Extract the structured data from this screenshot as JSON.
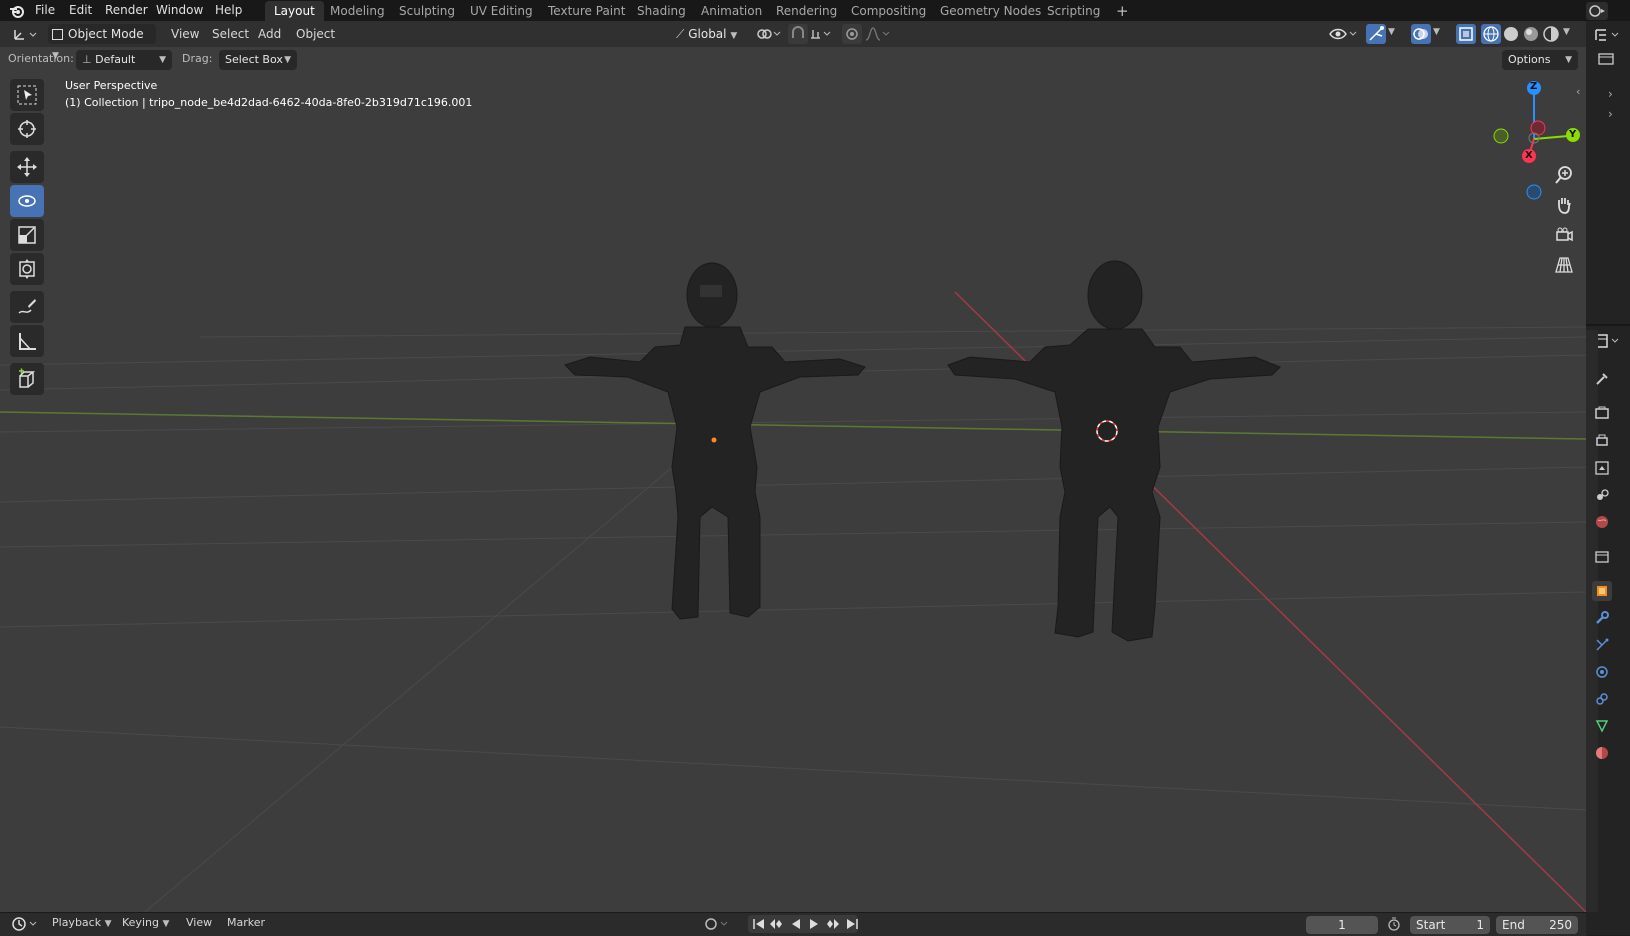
{
  "menubar": {
    "items": [
      "File",
      "Edit",
      "Render",
      "Window",
      "Help"
    ],
    "workspaces": [
      "Layout",
      "Modeling",
      "Sculpting",
      "UV Editing",
      "Texture Paint",
      "Shading",
      "Animation",
      "Rendering",
      "Compositing",
      "Geometry Nodes",
      "Scripting"
    ],
    "active_workspace": "Layout",
    "add_tab": "+"
  },
  "header": {
    "mode": "Object Mode",
    "menus": [
      "View",
      "Select",
      "Add",
      "Object"
    ],
    "transform_orientation": "Global"
  },
  "tool_settings": {
    "orientation_label": "Orientation:",
    "orientation_value": "Default",
    "drag_label": "Drag:",
    "drag_value": "Select Box",
    "options": "Options"
  },
  "viewport": {
    "perspective": "User Perspective",
    "collection_info": "(1) Collection | tripo_node_be4d2dad-6462-40da-8fe0-2b319d71c196.001",
    "gizmo_axes": {
      "z": "Z",
      "y": "Y",
      "x": "X"
    },
    "axis_colors": {
      "x": "#ff3352",
      "y": "#8bdc00",
      "z": "#2890ff"
    },
    "background": "#3d3d3d"
  },
  "timeline": {
    "menus": [
      "Playback",
      "Keying",
      "View",
      "Marker"
    ],
    "current_frame": "1",
    "start_label": "Start",
    "start_value": "1",
    "end_label": "End",
    "end_value": "250"
  }
}
